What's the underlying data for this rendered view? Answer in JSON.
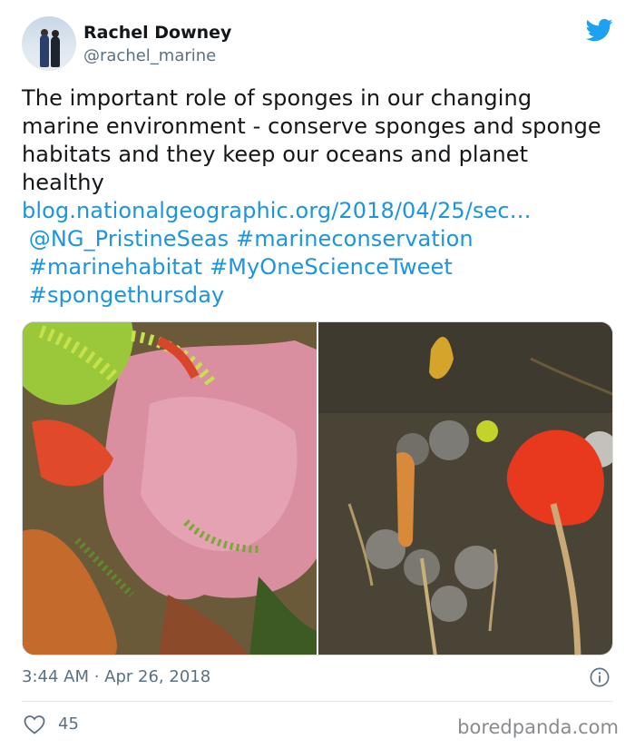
{
  "author": {
    "display_name": "Rachel Downey",
    "handle": "@rachel_marine"
  },
  "tweet": {
    "text": "The important role of sponges in our changing marine environment - conserve sponges and sponge habitats and they keep our oceans and planet healthy",
    "link": "blog.nationalgeographic.org/2018/04/25/sec…",
    "mention": "@NG_PristineSeas",
    "hashtags": [
      "#marineconservation",
      "#marinehabitat",
      "#MyOneScienceTweet",
      "#spongethursday"
    ]
  },
  "meta": {
    "timestamp": "3:44 AM · Apr 26, 2018",
    "like_count": "45"
  },
  "watermark": "boredpanda.com",
  "colors": {
    "link": "#1b95e0",
    "twitter_blue": "#1da1f2",
    "secondary_text": "#5b7083"
  },
  "icons": {
    "logo": "twitter-bird-icon",
    "info": "info-icon",
    "like": "heart-icon"
  }
}
